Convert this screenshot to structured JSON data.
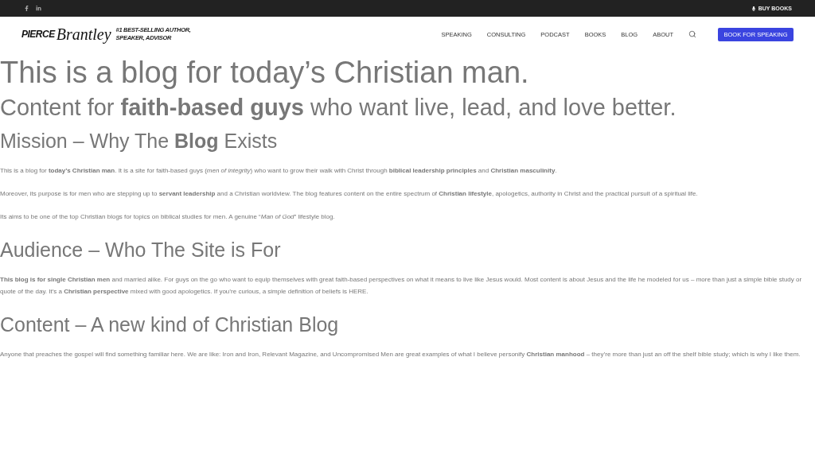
{
  "top_bar": {
    "social": [
      {
        "kind": "facebook"
      },
      {
        "kind": "linkedin"
      }
    ],
    "buy_books": "BUY BOOKS"
  },
  "header": {
    "logo": {
      "name": "PIERCE",
      "script": "Brantley"
    },
    "tagline": [
      "#1 BEST-SELLING AUTHOR,",
      "SPEAKER,  ADVISOR"
    ],
    "nav": [
      "SPEAKING",
      "CONSULTING",
      "PODCAST",
      "BOOKS",
      "BLOG",
      "ABOUT"
    ],
    "cta": "BOOK FOR SPEAKING"
  },
  "content": [
    {
      "kind": "h1",
      "text": "This is a blog for today’s Christian man."
    },
    {
      "kind": "h2",
      "text": "Content for **faith-based guys** who want live, lead, and love better."
    },
    {
      "kind": "h3",
      "text": "Mission – Why The **Blog** Exists"
    },
    {
      "kind": "p",
      "text": "This is a blog for **today’s Christian man**. It is a site for faith-based guys (*men of integrity*) who want to grow their walk with Christ through **biblical leadership principles** and **Christian masculinity**."
    },
    {
      "kind": "p",
      "text": "Moreover, its purpose is for men who are stepping up to **servant leadership** and a Christian worldview. The blog features content on the entire spectrum of **Christian lifestyle**, apologetics, authority in Christ and the practical pursuit of a spiritual life."
    },
    {
      "kind": "p",
      "text": "Its aims to be one of the top Christian blogs for topics on biblical studies for men. A genuine “*Man of God*” lifestyle blog."
    },
    {
      "kind": "h3",
      "text": "Audience – Who The Site is For"
    },
    {
      "kind": "p",
      "text": "**This blog is for single Christian men** and married alike. For guys on the go who want to equip themselves with great faith-based perspectives on what it means to live like Jesus would. Most content is about Jesus and the life he modeled for us – more than just a simple bible study or quote of the day.  It’s a **Christian perspective** mixed with good apologetics. If you’re curious, a simple definition of beliefs is HERE."
    },
    {
      "kind": "h3",
      "text": "Content – A new kind of Christian Blog"
    },
    {
      "kind": "p",
      "text": "Anyone that preaches the gospel will find something familiar here. We are like: Iron and Iron, Relevant Magazine, and Uncompromised Men are great examples of what I believe personify **Christian manhood** – they’re more than just an off the shelf bible study; which is why I like them."
    }
  ]
}
